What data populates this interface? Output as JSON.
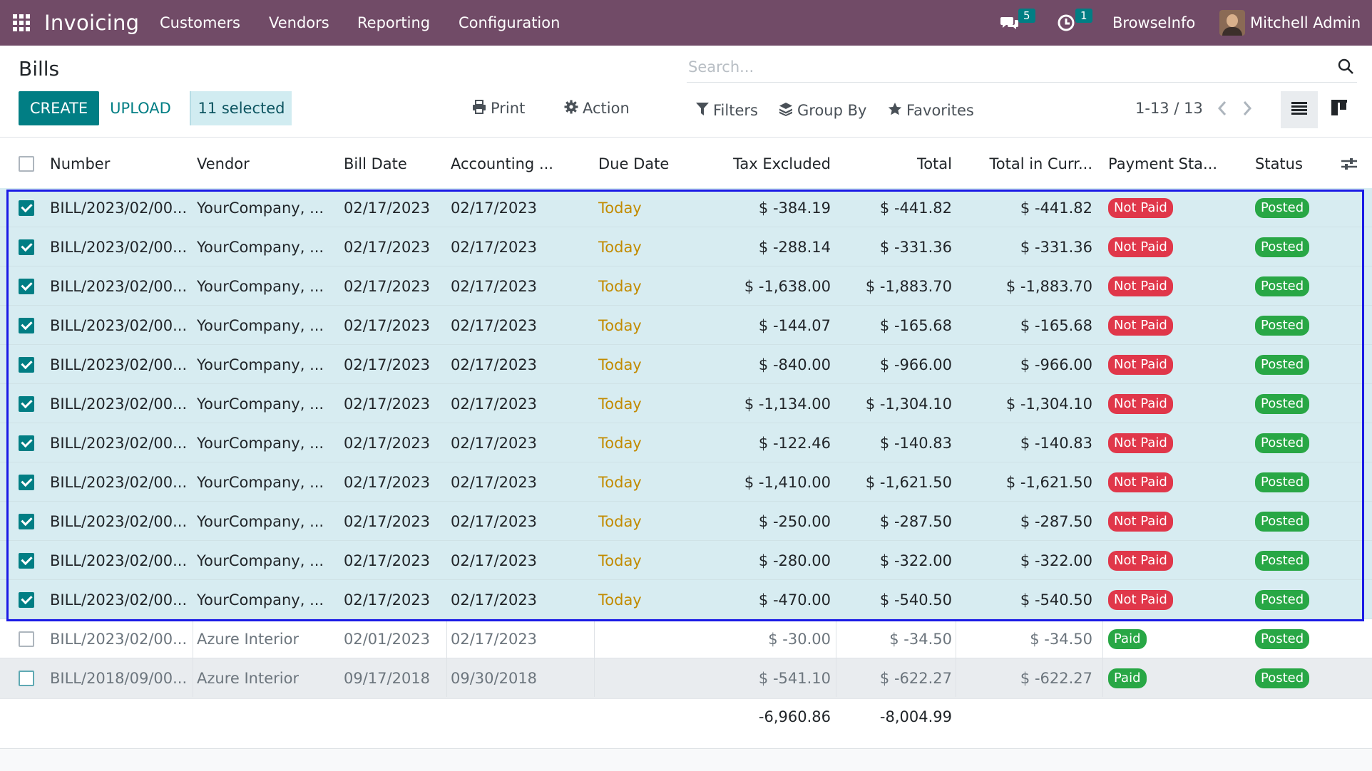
{
  "navbar": {
    "app_title": "Invoicing",
    "menu": [
      "Customers",
      "Vendors",
      "Reporting",
      "Configuration"
    ],
    "messages_badge": "5",
    "activities_badge": "1",
    "company": "BrowseInfo",
    "user": "Mitchell Admin",
    "icons": [
      "apps-grid-icon",
      "chat-icon",
      "clock-icon"
    ],
    "bg_color": "#714b67"
  },
  "control_panel": {
    "title": "Bills",
    "search_placeholder": "Search...",
    "create_label": "CREATE",
    "upload_label": "UPLOAD",
    "selected_label": "11 selected",
    "print_label": "Print",
    "action_label": "Action",
    "filters_label": "Filters",
    "group_by_label": "Group By",
    "favorites_label": "Favorites",
    "pager": "1-13 / 13"
  },
  "table": {
    "columns": [
      "Number",
      "Vendor",
      "Bill Date",
      "Accounting ...",
      "Due Date",
      "Tax Excluded",
      "Total",
      "Total in Curr...",
      "Payment Sta...",
      "Status"
    ],
    "rows": [
      {
        "selected": true,
        "number": "BILL/2023/02/00...",
        "vendor": "YourCompany, ...",
        "bill_date": "02/17/2023",
        "accounting_date": "02/17/2023",
        "due_date": "Today",
        "tax_excluded": "$ -384.19",
        "total": "$ -441.82",
        "total_curr": "$ -441.82",
        "payment": "Not Paid",
        "status": "Posted"
      },
      {
        "selected": true,
        "number": "BILL/2023/02/00...",
        "vendor": "YourCompany, ...",
        "bill_date": "02/17/2023",
        "accounting_date": "02/17/2023",
        "due_date": "Today",
        "tax_excluded": "$ -288.14",
        "total": "$ -331.36",
        "total_curr": "$ -331.36",
        "payment": "Not Paid",
        "status": "Posted"
      },
      {
        "selected": true,
        "number": "BILL/2023/02/00...",
        "vendor": "YourCompany, ...",
        "bill_date": "02/17/2023",
        "accounting_date": "02/17/2023",
        "due_date": "Today",
        "tax_excluded": "$ -1,638.00",
        "total": "$ -1,883.70",
        "total_curr": "$ -1,883.70",
        "payment": "Not Paid",
        "status": "Posted"
      },
      {
        "selected": true,
        "number": "BILL/2023/02/00...",
        "vendor": "YourCompany, ...",
        "bill_date": "02/17/2023",
        "accounting_date": "02/17/2023",
        "due_date": "Today",
        "tax_excluded": "$ -144.07",
        "total": "$ -165.68",
        "total_curr": "$ -165.68",
        "payment": "Not Paid",
        "status": "Posted"
      },
      {
        "selected": true,
        "number": "BILL/2023/02/00...",
        "vendor": "YourCompany, ...",
        "bill_date": "02/17/2023",
        "accounting_date": "02/17/2023",
        "due_date": "Today",
        "tax_excluded": "$ -840.00",
        "total": "$ -966.00",
        "total_curr": "$ -966.00",
        "payment": "Not Paid",
        "status": "Posted"
      },
      {
        "selected": true,
        "number": "BILL/2023/02/00...",
        "vendor": "YourCompany, ...",
        "bill_date": "02/17/2023",
        "accounting_date": "02/17/2023",
        "due_date": "Today",
        "tax_excluded": "$ -1,134.00",
        "total": "$ -1,304.10",
        "total_curr": "$ -1,304.10",
        "payment": "Not Paid",
        "status": "Posted"
      },
      {
        "selected": true,
        "number": "BILL/2023/02/00...",
        "vendor": "YourCompany, ...",
        "bill_date": "02/17/2023",
        "accounting_date": "02/17/2023",
        "due_date": "Today",
        "tax_excluded": "$ -122.46",
        "total": "$ -140.83",
        "total_curr": "$ -140.83",
        "payment": "Not Paid",
        "status": "Posted"
      },
      {
        "selected": true,
        "number": "BILL/2023/02/00...",
        "vendor": "YourCompany, ...",
        "bill_date": "02/17/2023",
        "accounting_date": "02/17/2023",
        "due_date": "Today",
        "tax_excluded": "$ -1,410.00",
        "total": "$ -1,621.50",
        "total_curr": "$ -1,621.50",
        "payment": "Not Paid",
        "status": "Posted"
      },
      {
        "selected": true,
        "number": "BILL/2023/02/00...",
        "vendor": "YourCompany, ...",
        "bill_date": "02/17/2023",
        "accounting_date": "02/17/2023",
        "due_date": "Today",
        "tax_excluded": "$ -250.00",
        "total": "$ -287.50",
        "total_curr": "$ -287.50",
        "payment": "Not Paid",
        "status": "Posted"
      },
      {
        "selected": true,
        "number": "BILL/2023/02/00...",
        "vendor": "YourCompany, ...",
        "bill_date": "02/17/2023",
        "accounting_date": "02/17/2023",
        "due_date": "Today",
        "tax_excluded": "$ -280.00",
        "total": "$ -322.00",
        "total_curr": "$ -322.00",
        "payment": "Not Paid",
        "status": "Posted"
      },
      {
        "selected": true,
        "number": "BILL/2023/02/00...",
        "vendor": "YourCompany, ...",
        "bill_date": "02/17/2023",
        "accounting_date": "02/17/2023",
        "due_date": "Today",
        "tax_excluded": "$ -470.00",
        "total": "$ -540.50",
        "total_curr": "$ -540.50",
        "payment": "Not Paid",
        "status": "Posted"
      },
      {
        "selected": false,
        "number": "BILL/2023/02/00...",
        "vendor": "Azure Interior",
        "bill_date": "02/01/2023",
        "accounting_date": "02/17/2023",
        "due_date": "",
        "tax_excluded": "$ -30.00",
        "total": "$ -34.50",
        "total_curr": "$ -34.50",
        "payment": "Paid",
        "status": "Posted"
      },
      {
        "selected": false,
        "number": "BILL/2018/09/00...",
        "vendor": "Azure Interior",
        "bill_date": "09/17/2018",
        "accounting_date": "09/30/2018",
        "due_date": "",
        "tax_excluded": "$ -541.10",
        "total": "$ -622.27",
        "total_curr": "$ -622.27",
        "payment": "Paid",
        "status": "Posted"
      }
    ],
    "footer": {
      "tax_excluded_sum": "-6,960.86",
      "total_sum": "-8,004.99"
    }
  },
  "colors": {
    "accent": "#017e84",
    "selected_row": "#d7ecf1",
    "not_paid": "#e0374a",
    "paid_posted": "#28a745",
    "today": "#c28b00",
    "selection_frame": "#1a1ae6"
  }
}
